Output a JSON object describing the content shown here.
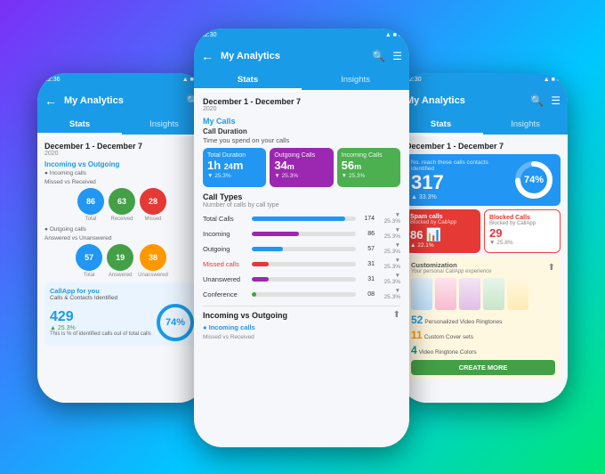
{
  "app": {
    "title": "My Analytics",
    "back_label": "←",
    "search_icon": "🔍",
    "filter_icon": "⚙",
    "tabs": [
      {
        "label": "Stats",
        "active": true
      },
      {
        "label": "Insights",
        "active": false
      }
    ],
    "date_range": "December 1 - December 7",
    "year": "2020"
  },
  "center": {
    "my_calls_title": "My Calls",
    "call_duration_title": "Call Duration",
    "call_duration_sub": "Time you spend on your calls",
    "stat_cards": [
      {
        "label": "Total Duration",
        "value": "1h 24m",
        "value1": "1h",
        "value2": "24",
        "unit": "m",
        "change": "▼ 25.3%",
        "color": "blue"
      },
      {
        "label": "Outgoing Calls",
        "value": "34m",
        "change": "▼ 25.3%",
        "color": "purple"
      },
      {
        "label": "Incoming Calls",
        "value": "56m",
        "change": "▼ 25.3%",
        "color": "green"
      }
    ],
    "call_types_title": "Call Types",
    "call_types_sub": "Number of calls by call type",
    "call_rows": [
      {
        "label": "Total Calls",
        "value": "174",
        "change": "▼ 25.3%",
        "bar_pct": 90,
        "color": "#2196f3"
      },
      {
        "label": "Incoming",
        "value": "86",
        "change": "▼ 25.3%",
        "bar_pct": 45,
        "color": "#9c27b0"
      },
      {
        "label": "Outgoing",
        "value": "57",
        "change": "▼ 25.3%",
        "bar_pct": 30,
        "color": "#2196f3"
      },
      {
        "label": "Missed calls",
        "value": "31",
        "change": "▼ 25.3%",
        "bar_pct": 16,
        "color": "#e53935",
        "missed": true
      },
      {
        "label": "Unanswered",
        "value": "31",
        "change": "▼ 25.3%",
        "bar_pct": 16,
        "color": "#9c27b0"
      },
      {
        "label": "Conference",
        "value": "08",
        "change": "▼ 25.3%",
        "bar_pct": 4,
        "color": "#43a047"
      }
    ],
    "incoming_vs_outgoing": "Incoming vs Outgoing",
    "incoming_calls_label": "● Incoming calls",
    "incoming_calls_sub": "Missed vs Received"
  },
  "left": {
    "date_range": "December 1 - December 7",
    "year": "2020",
    "incoming_vs_outgoing": "Incoming vs Outgoing",
    "incoming_calls": {
      "title": "● Incoming calls",
      "sub": "Missed vs Received",
      "circles": [
        {
          "label": "Total",
          "value": "86",
          "color": "#2196f3"
        },
        {
          "label": "Received",
          "value": "63",
          "color": "#43a047"
        },
        {
          "label": "Missed",
          "value": "28",
          "color": "#e53935"
        }
      ]
    },
    "outgoing_calls": {
      "title": "● Outgoing calls",
      "sub": "Answered vs Unanswered",
      "circles": [
        {
          "label": "Total",
          "value": "57",
          "color": "#2196f3"
        },
        {
          "label": "Answered",
          "value": "19",
          "color": "#43a047"
        },
        {
          "label": "Unanswered",
          "value": "38",
          "color": "#ff9800"
        }
      ]
    },
    "callapp_title": "CallApp for you",
    "callapp_sub": "Calls & Contacts Identified",
    "callapp_desc": "This is % of identified calls out of total calls",
    "callapp_big": "429",
    "callapp_change": "▲ 25.3%",
    "callapp_percent": "74%"
  },
  "right": {
    "date_range": "December 1 - December 7",
    "big_num": "317",
    "big_change": "▲ 33.3%",
    "spam_title": "Spam calls",
    "spam_sub": "Blocked by CallApp",
    "spam_num": "86",
    "spam_change": "▲ 22.1%",
    "blocked_title": "Blocked Calls",
    "blocked_sub": "Blocked by CallApp",
    "blocked_num": "29",
    "blocked_change": "▼ 25.8%",
    "custom_title": "Customization",
    "custom_sub": "Your personal CallApp experience",
    "custom_stats": [
      {
        "num": "52",
        "label": "Personalized Video Ringtones",
        "color": "blue"
      },
      {
        "num": "11",
        "label": "Custom Cover sets",
        "color": "orange"
      },
      {
        "num": "4",
        "label": "Video Ringtone Colors",
        "color": "teal"
      }
    ],
    "create_btn": "CREATE MORE",
    "percent_74": "74%"
  }
}
